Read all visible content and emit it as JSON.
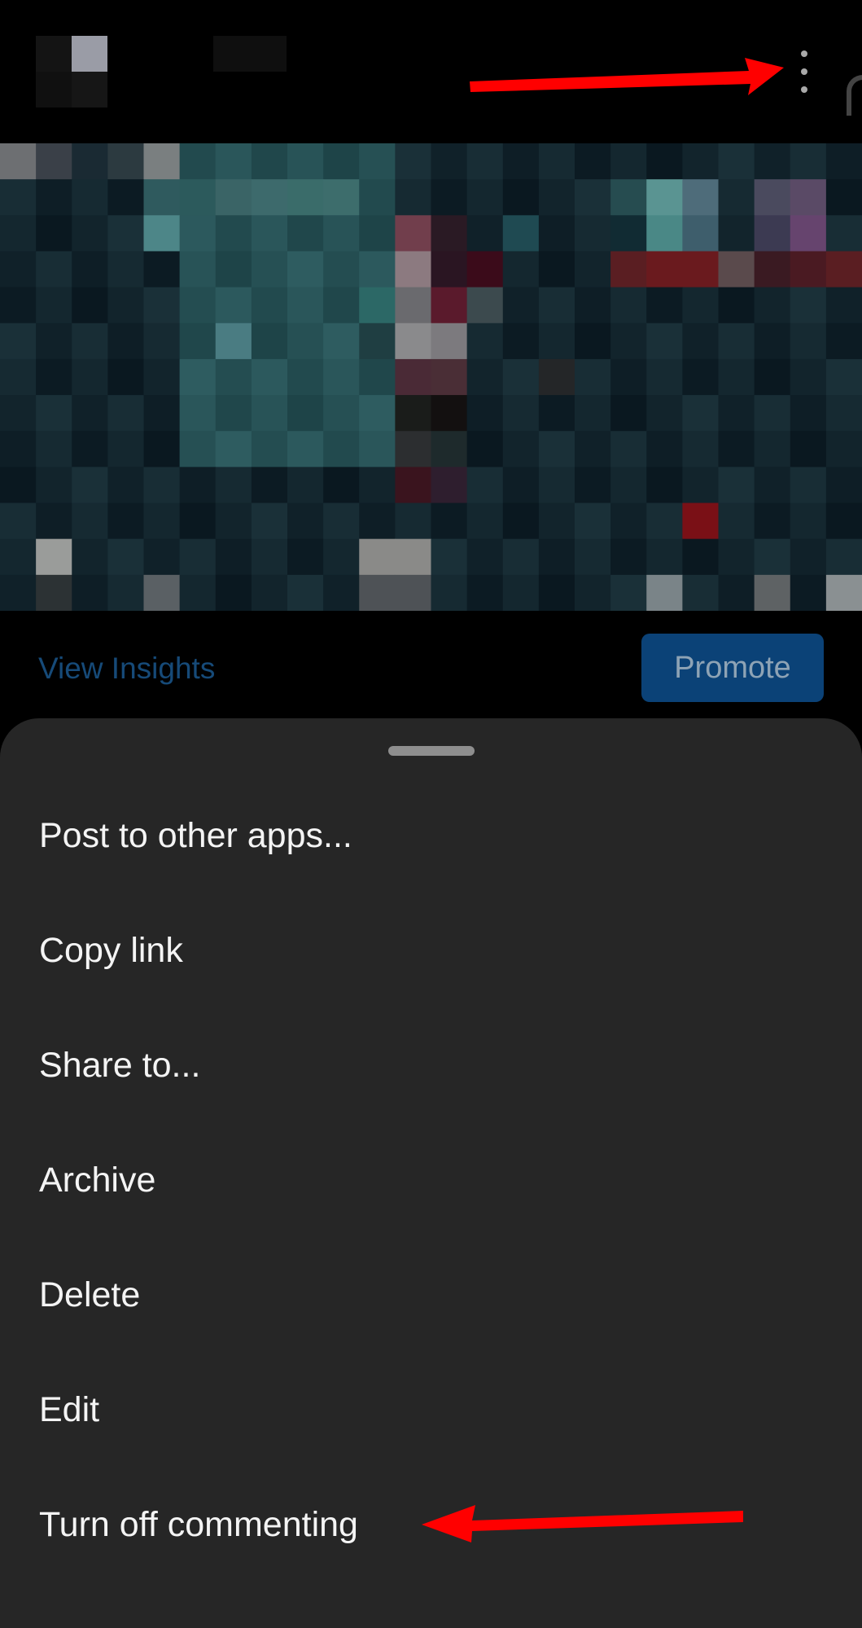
{
  "header": {
    "avatar_icon": "profile-avatar-pixelated",
    "more_icon": "vertical-ellipsis-icon"
  },
  "post": {
    "image_icon": "pixelated-post-photo"
  },
  "actions": {
    "view_insights_label": "View Insights",
    "promote_label": "Promote"
  },
  "sheet": {
    "items": [
      {
        "label": "Post to other apps..."
      },
      {
        "label": "Copy link"
      },
      {
        "label": "Share to..."
      },
      {
        "label": "Archive"
      },
      {
        "label": "Delete"
      },
      {
        "label": "Edit"
      },
      {
        "label": "Turn off commenting"
      }
    ]
  },
  "colors": {
    "background": "#000000",
    "sheet": "#262626",
    "link": "#164a78",
    "promote_bg": "#0b4277",
    "annotation_arrow": "#ff0000"
  }
}
